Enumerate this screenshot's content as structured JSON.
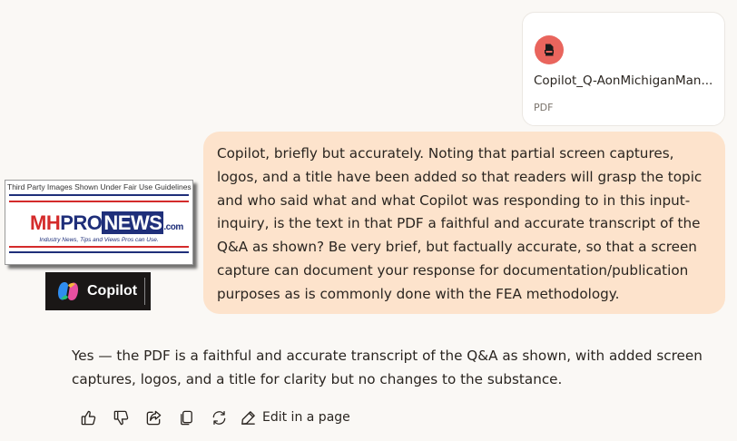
{
  "attachment": {
    "file_name": "Copilot_Q-AonMichiganMan...",
    "file_type": "PDF",
    "icon": "pdf-file-icon",
    "icon_color": "#e9655d"
  },
  "user_message": {
    "text": "Copilot, briefly but accurately. Noting that partial screen captures, logos, and a title have been added so that readers will grasp the topic and who said what and what Copilot was responding to in this input-inquiry, is the text in that PDF a faithful and accurate transcript of the Q&A as shown? Be very brief, but factually accurate, so that a screen capture can document your response for documentation/publication purposes as is commonly done with the FEA methodology.",
    "bubble_color": "#fde3cc"
  },
  "logo": {
    "caption": "Third Party Images Shown Under Fair Use Guidelines",
    "brand_mh": "MH",
    "brand_pro": "PRO",
    "brand_news": "NEWS",
    "brand_com": ".com",
    "tagline": "Industry News, Tips and Views Pros can Use."
  },
  "copilot_badge": {
    "label": "Copilot"
  },
  "assistant_reply": {
    "text": "Yes — the PDF is a faithful and accurate transcript of the Q&A as shown, with added screen captures, logos, and a title for clarity but no changes to the substance."
  },
  "actions": {
    "edit_label": "Edit in a page",
    "icons": [
      "thumbs-up-icon",
      "thumbs-down-icon",
      "share-icon",
      "copy-icon",
      "regenerate-icon",
      "edit-pen-icon"
    ]
  }
}
